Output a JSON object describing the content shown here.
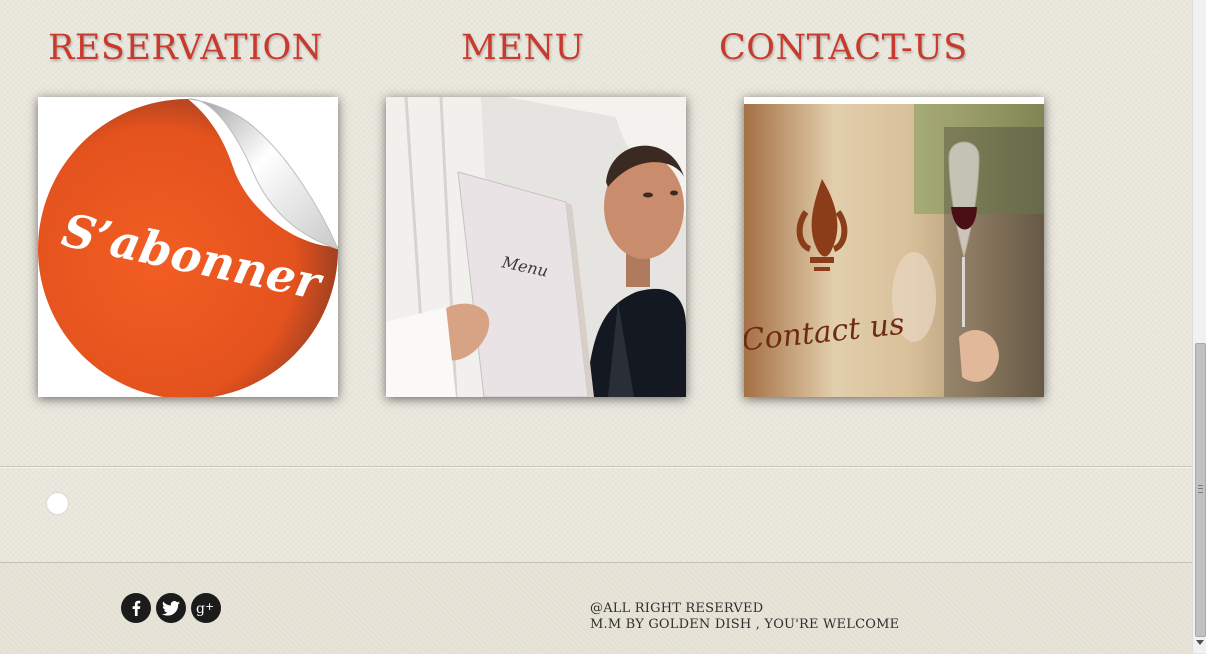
{
  "sections": {
    "reservation": {
      "title": "RESERVATION",
      "badge_text": "S’abonner"
    },
    "menu": {
      "title": "MENU",
      "book_text": "Menu"
    },
    "contact": {
      "title": "CONTACT-US",
      "sign_text": "Contact us"
    }
  },
  "footer": {
    "social": [
      "facebook-icon",
      "twitter-icon",
      "google-plus-icon"
    ],
    "rights_line": "@ALL RIGHT RESERVED",
    "credit_line": "M.M BY GOLDEN DISH , YOU'RE WELCOME"
  },
  "colors": {
    "heading": "#c83a2e",
    "sticker_orange": "#e8561f",
    "footer_text": "#2f2f2f",
    "social_bg": "#1b1b1b"
  }
}
